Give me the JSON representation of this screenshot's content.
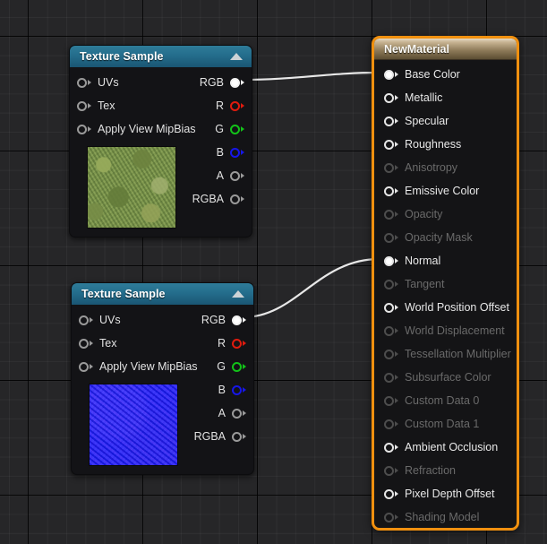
{
  "editor": {
    "name": "unreal-material-graph-editor",
    "background_color": "#262628",
    "grid_minor_color": "#2d2d2f",
    "grid_major_color": "#0a0a0a"
  },
  "nodes": [
    {
      "id": "texture-sample-basecolor",
      "title": "Texture Sample",
      "header_color": "#246d8c",
      "collapse_icon": "collapse-up-arrow-icon",
      "thumbnail": "grass-diffuse-thumbnail",
      "inputs": [
        {
          "label": "UVs",
          "color": "gray",
          "connected": false
        },
        {
          "label": "Tex",
          "color": "gray",
          "connected": false
        },
        {
          "label": "Apply View MipBias",
          "color": "gray",
          "connected": false
        }
      ],
      "outputs": [
        {
          "label": "RGB",
          "color": "white",
          "connected": true
        },
        {
          "label": "R",
          "color": "red",
          "connected": false
        },
        {
          "label": "G",
          "color": "green",
          "connected": false
        },
        {
          "label": "B",
          "color": "blue",
          "connected": false
        },
        {
          "label": "A",
          "color": "gray",
          "connected": false
        },
        {
          "label": "RGBA",
          "color": "gray",
          "connected": false
        }
      ]
    },
    {
      "id": "texture-sample-normal",
      "title": "Texture Sample",
      "header_color": "#246d8c",
      "collapse_icon": "collapse-up-arrow-icon",
      "thumbnail": "normal-map-thumbnail",
      "inputs": [
        {
          "label": "UVs",
          "color": "gray",
          "connected": false
        },
        {
          "label": "Tex",
          "color": "gray",
          "connected": false
        },
        {
          "label": "Apply View MipBias",
          "color": "gray",
          "connected": false
        }
      ],
      "outputs": [
        {
          "label": "RGB",
          "color": "white",
          "connected": true
        },
        {
          "label": "R",
          "color": "red",
          "connected": false
        },
        {
          "label": "G",
          "color": "green",
          "connected": false
        },
        {
          "label": "B",
          "color": "blue",
          "connected": false
        },
        {
          "label": "A",
          "color": "gray",
          "connected": false
        },
        {
          "label": "RGBA",
          "color": "gray",
          "connected": false
        }
      ]
    }
  ],
  "material_node": {
    "id": "material-result-node",
    "title": "NewMaterial",
    "border_color": "#f0900f",
    "header_gradient_top": "#e3d9c4",
    "header_gradient_bottom": "#5c4e33",
    "inputs": [
      {
        "label": "Base Color",
        "enabled": true,
        "connected": true
      },
      {
        "label": "Metallic",
        "enabled": true,
        "connected": false
      },
      {
        "label": "Specular",
        "enabled": true,
        "connected": false
      },
      {
        "label": "Roughness",
        "enabled": true,
        "connected": false
      },
      {
        "label": "Anisotropy",
        "enabled": false,
        "connected": false
      },
      {
        "label": "Emissive Color",
        "enabled": true,
        "connected": false
      },
      {
        "label": "Opacity",
        "enabled": false,
        "connected": false
      },
      {
        "label": "Opacity Mask",
        "enabled": false,
        "connected": false
      },
      {
        "label": "Normal",
        "enabled": true,
        "connected": true
      },
      {
        "label": "Tangent",
        "enabled": false,
        "connected": false
      },
      {
        "label": "World Position Offset",
        "enabled": true,
        "connected": false
      },
      {
        "label": "World Displacement",
        "enabled": false,
        "connected": false
      },
      {
        "label": "Tessellation Multiplier",
        "enabled": false,
        "connected": false
      },
      {
        "label": "Subsurface Color",
        "enabled": false,
        "connected": false
      },
      {
        "label": "Custom Data 0",
        "enabled": false,
        "connected": false
      },
      {
        "label": "Custom Data 1",
        "enabled": false,
        "connected": false
      },
      {
        "label": "Ambient Occlusion",
        "enabled": true,
        "connected": false
      },
      {
        "label": "Refraction",
        "enabled": false,
        "connected": false
      },
      {
        "label": "Pixel Depth Offset",
        "enabled": true,
        "connected": false
      },
      {
        "label": "Shading Model",
        "enabled": false,
        "connected": false
      }
    ]
  },
  "wires": [
    {
      "id": "wire-basecolor",
      "from": "texture-sample-basecolor.RGB",
      "to": "NewMaterial.Base Color",
      "color": "#e8e8e8"
    },
    {
      "id": "wire-normal",
      "from": "texture-sample-normal.RGB",
      "to": "NewMaterial.Normal",
      "color": "#e8e8e8"
    }
  ]
}
